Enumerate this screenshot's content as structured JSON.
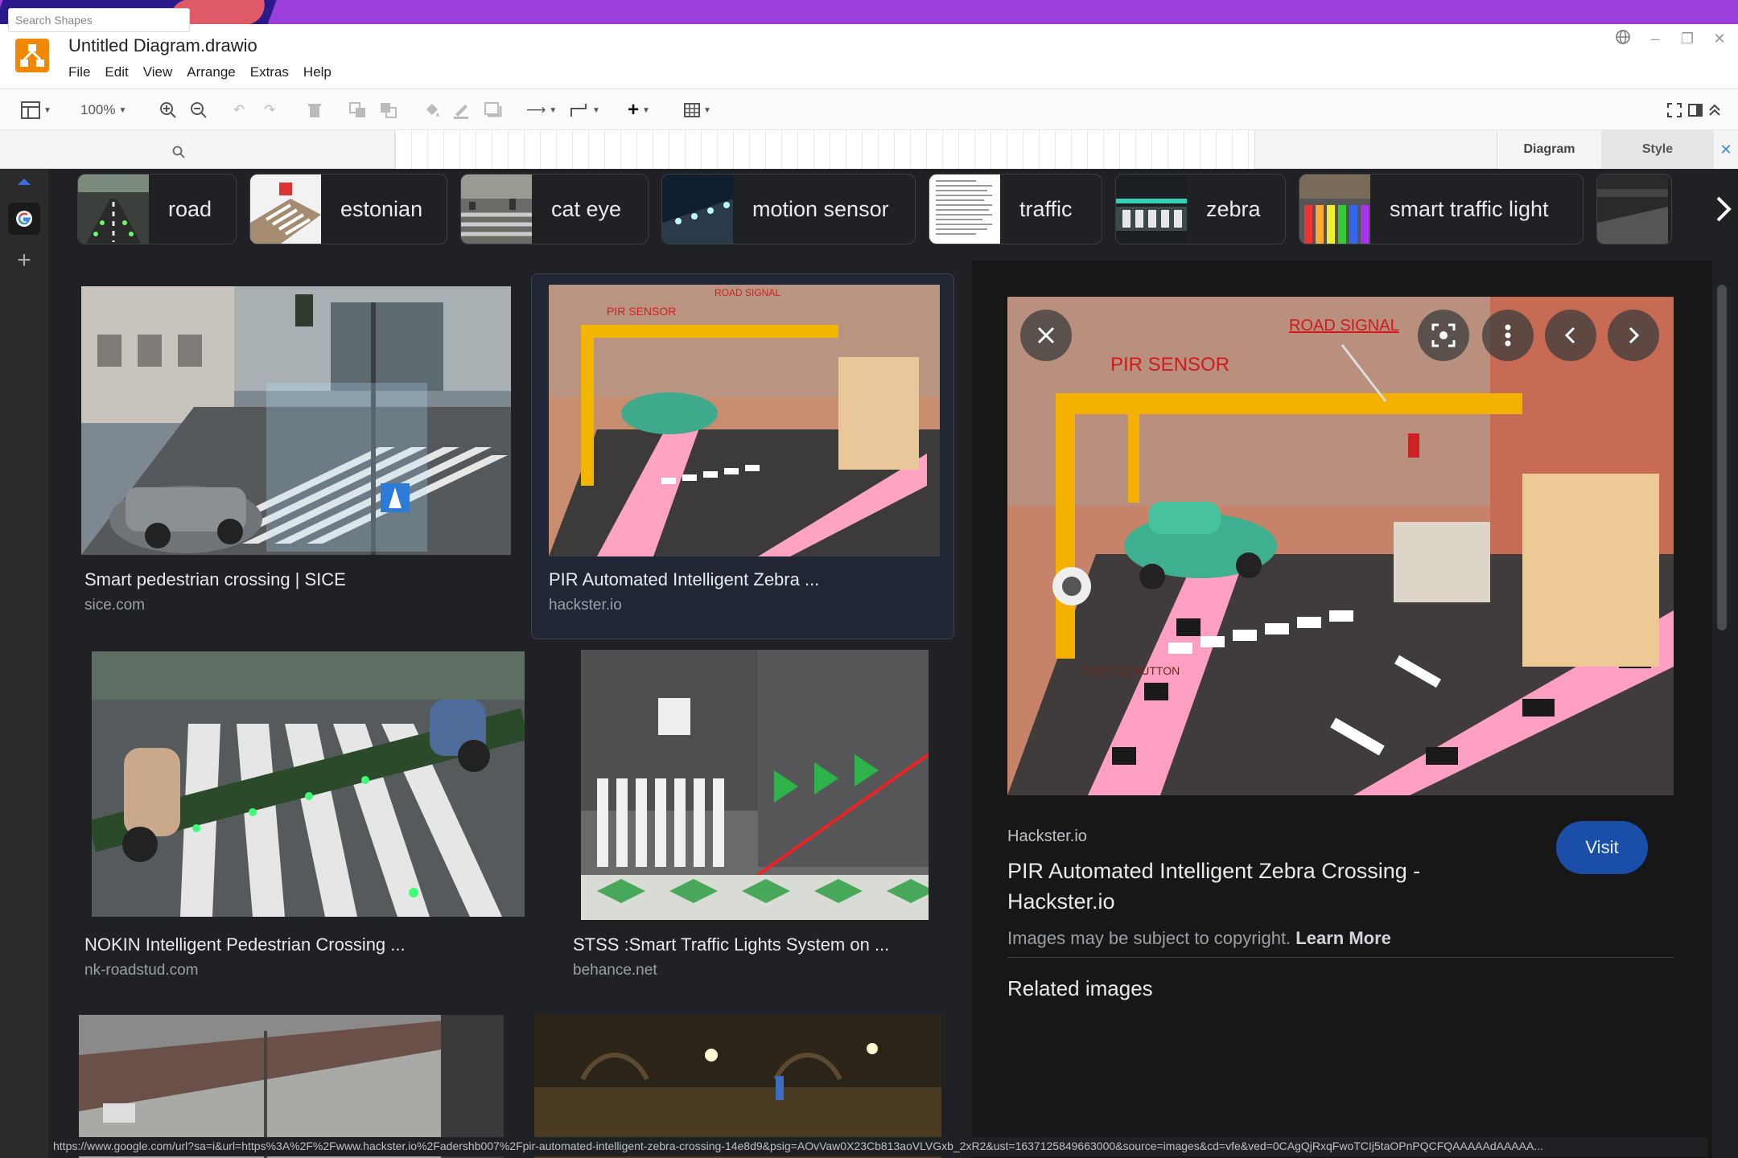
{
  "window": {
    "doc_title": "Untitled Diagram.drawio",
    "menu": [
      "File",
      "Edit",
      "View",
      "Arrange",
      "Extras",
      "Help"
    ]
  },
  "toolbar": {
    "zoom": "100%"
  },
  "shapes": {
    "search_placeholder": "Search Shapes"
  },
  "format_panel": {
    "diagram_tab": "Diagram",
    "style_tab": "Style"
  },
  "chips": [
    {
      "label": "road"
    },
    {
      "label": "estonian"
    },
    {
      "label": "cat eye"
    },
    {
      "label": "motion sensor"
    },
    {
      "label": "traffic"
    },
    {
      "label": "zebra"
    },
    {
      "label": "smart traffic light"
    }
  ],
  "results": [
    {
      "title": "Smart pedestrian crossing | SICE",
      "source": "sice.com"
    },
    {
      "title": "PIR Automated Intelligent Zebra ...",
      "source": "hackster.io"
    },
    {
      "title": "NOKIN Intelligent Pedestrian Crossing ...",
      "source": "nk-roadstud.com"
    },
    {
      "title": "STSS :Smart Traffic Lights System on ...",
      "source": "behance.net"
    }
  ],
  "preview": {
    "site": "Hackster.io",
    "title": "PIR Automated Intelligent Zebra Crossing - Hackster.io",
    "visit": "Visit",
    "copyright": "Images may be subject to copyright.",
    "learn_more": "Learn More",
    "related": "Related images",
    "image_labels": {
      "sensor": "PIR SENSOR",
      "signal": "ROAD SIGNAL",
      "button": "OVERIDE BUTTON"
    }
  },
  "status_url": "https://www.google.com/url?sa=i&url=https%3A%2F%2Fwww.hackster.io%2Fadershb007%2Fpir-automated-intelligent-zebra-crossing-14e8d9&psig=AOvVaw0X23Cb813aoVLVGxb_2xR2&ust=1637125849663000&source=images&cd=vfe&ved=0CAgQjRxqFwoTCIj5taOPnPQCFQAAAAAdAAAAA...",
  "colors": {
    "drawio_orange": "#f08705",
    "google_dark_bg": "#202124",
    "visit_button": "#1a4ea8"
  }
}
